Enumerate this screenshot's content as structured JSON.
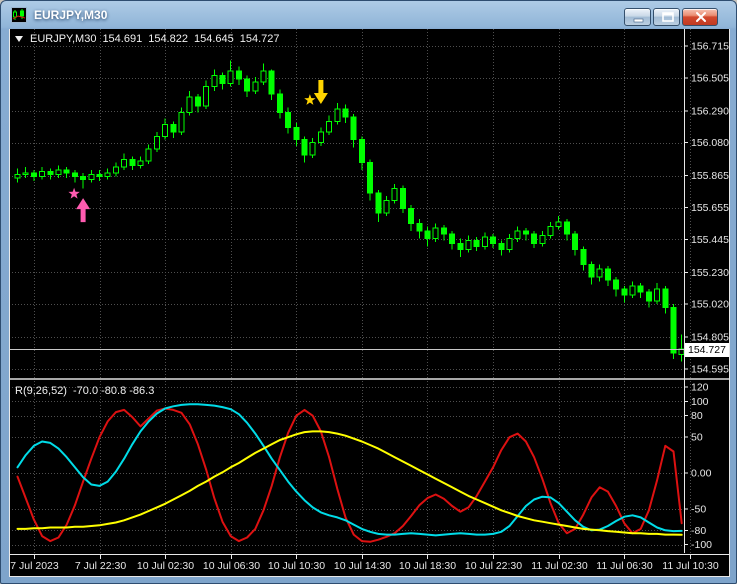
{
  "window": {
    "title": "EURJPY,M30",
    "controls": [
      {
        "name": "minimize"
      },
      {
        "name": "maximize"
      },
      {
        "name": "close"
      }
    ]
  },
  "quote": {
    "symbol": "EURJPY,M30",
    "open": "154.691",
    "high": "154.822",
    "low": "154.645",
    "close": "154.727",
    "bid": "154.727"
  },
  "indicator_header": {
    "name": "R(9,26,52)",
    "values": "-70.0 -80.8 -86.3"
  },
  "colors": {
    "background": "#000000",
    "grid": "#4f4f4f",
    "axis_text": "#e6e6e6",
    "axis_line": "#e8e8e8",
    "separator": "#a8a8a8",
    "bull": "#00ff00",
    "bid_line": "#c8c8c8",
    "red_line": "#dd1111",
    "cyan_line": "#00dce8",
    "yellow_line": "#ffff00",
    "buy_marker": "#ff5bb0",
    "sell_marker": "#ffd400"
  },
  "chart_data": [
    {
      "type": "candlestick",
      "title": "EURJPY,M30",
      "ylim": [
        154.595,
        156.715
      ],
      "y_ticks": [
        "156.715",
        "156.505",
        "156.290",
        "156.080",
        "155.865",
        "155.655",
        "155.445",
        "155.230",
        "155.020",
        "154.805",
        "154.595"
      ],
      "x_ticks": {
        "labels": [
          "7 Jul 2023",
          "7 Jul 22:30",
          "10 Jul 02:30",
          "10 Jul 06:30",
          "10 Jul 10:30",
          "10 Jul 14:30",
          "10 Jul 18:30",
          "10 Jul 22:30",
          "11 Jul 02:30",
          "11 Jul 06:30",
          "11 Jul 10:30"
        ],
        "first_bar": 2,
        "bar_step": 8
      },
      "bid": 154.727,
      "ohlc": [
        [
          155.85,
          155.91,
          155.82,
          155.87
        ],
        [
          155.87,
          155.92,
          155.85,
          155.88
        ],
        [
          155.88,
          155.9,
          155.83,
          155.86
        ],
        [
          155.86,
          155.92,
          155.84,
          155.89
        ],
        [
          155.89,
          155.91,
          155.84,
          155.87
        ],
        [
          155.87,
          155.93,
          155.85,
          155.9
        ],
        [
          155.9,
          155.92,
          155.85,
          155.88
        ],
        [
          155.88,
          155.9,
          155.82,
          155.86
        ],
        [
          155.86,
          155.88,
          155.78,
          155.84
        ],
        [
          155.84,
          155.9,
          155.82,
          155.87
        ],
        [
          155.87,
          155.9,
          155.83,
          155.86
        ],
        [
          155.86,
          155.91,
          155.84,
          155.88
        ],
        [
          155.88,
          155.95,
          155.86,
          155.92
        ],
        [
          155.92,
          156.01,
          155.9,
          155.97
        ],
        [
          155.97,
          155.99,
          155.9,
          155.93
        ],
        [
          155.93,
          155.99,
          155.91,
          155.96
        ],
        [
          155.96,
          156.07,
          155.94,
          156.04
        ],
        [
          156.04,
          156.15,
          156.02,
          156.12
        ],
        [
          156.12,
          156.24,
          156.1,
          156.2
        ],
        [
          156.2,
          156.22,
          156.11,
          156.15
        ],
        [
          156.15,
          156.31,
          156.13,
          156.28
        ],
        [
          156.28,
          156.42,
          156.26,
          156.38
        ],
        [
          156.38,
          156.4,
          156.28,
          156.32
        ],
        [
          156.32,
          156.49,
          156.3,
          156.45
        ],
        [
          156.45,
          156.56,
          156.42,
          156.52
        ],
        [
          156.52,
          156.54,
          156.43,
          156.47
        ],
        [
          156.47,
          156.62,
          156.45,
          156.55
        ],
        [
          156.55,
          156.58,
          156.46,
          156.5
        ],
        [
          156.5,
          156.52,
          156.38,
          156.42
        ],
        [
          156.42,
          156.51,
          156.4,
          156.48
        ],
        [
          156.48,
          156.6,
          156.46,
          156.55
        ],
        [
          156.55,
          156.56,
          156.36,
          156.4
        ],
        [
          156.4,
          156.43,
          156.24,
          156.28
        ],
        [
          156.28,
          156.31,
          156.14,
          156.18
        ],
        [
          156.18,
          156.21,
          156.06,
          156.1
        ],
        [
          156.1,
          156.12,
          155.95,
          156.0
        ],
        [
          156.0,
          156.11,
          155.98,
          156.08
        ],
        [
          156.08,
          156.18,
          156.06,
          156.15
        ],
        [
          156.15,
          156.26,
          156.13,
          156.22
        ],
        [
          156.22,
          156.34,
          156.2,
          156.3
        ],
        [
          156.3,
          156.33,
          156.21,
          156.25
        ],
        [
          156.25,
          156.27,
          156.05,
          156.1
        ],
        [
          156.1,
          156.12,
          155.9,
          155.95
        ],
        [
          155.95,
          155.97,
          155.7,
          155.75
        ],
        [
          155.75,
          155.77,
          155.56,
          155.62
        ],
        [
          155.62,
          155.73,
          155.6,
          155.7
        ],
        [
          155.7,
          155.81,
          155.68,
          155.78
        ],
        [
          155.78,
          155.8,
          155.62,
          155.65
        ],
        [
          155.65,
          155.67,
          155.5,
          155.55
        ],
        [
          155.55,
          155.58,
          155.45,
          155.5
        ],
        [
          155.5,
          155.53,
          155.4,
          155.45
        ],
        [
          155.45,
          155.55,
          155.43,
          155.52
        ],
        [
          155.52,
          155.54,
          155.44,
          155.48
        ],
        [
          155.48,
          155.5,
          155.38,
          155.42
        ],
        [
          155.42,
          155.45,
          155.33,
          155.38
        ],
        [
          155.38,
          155.47,
          155.36,
          155.44
        ],
        [
          155.44,
          155.46,
          155.37,
          155.4
        ],
        [
          155.4,
          155.49,
          155.38,
          155.46
        ],
        [
          155.46,
          155.48,
          155.39,
          155.42
        ],
        [
          155.42,
          155.44,
          155.34,
          155.38
        ],
        [
          155.38,
          155.48,
          155.36,
          155.45
        ],
        [
          155.45,
          155.53,
          155.43,
          155.5
        ],
        [
          155.5,
          155.52,
          155.44,
          155.48
        ],
        [
          155.48,
          155.5,
          155.39,
          155.42
        ],
        [
          155.42,
          155.5,
          155.4,
          155.47
        ],
        [
          155.47,
          155.56,
          155.45,
          155.53
        ],
        [
          155.53,
          155.6,
          155.51,
          155.56
        ],
        [
          155.56,
          155.58,
          155.44,
          155.48
        ],
        [
          155.48,
          155.5,
          155.34,
          155.38
        ],
        [
          155.38,
          155.4,
          155.24,
          155.28
        ],
        [
          155.28,
          155.3,
          155.15,
          155.2
        ],
        [
          155.2,
          155.28,
          155.17,
          155.25
        ],
        [
          155.25,
          155.27,
          155.14,
          155.18
        ],
        [
          155.18,
          155.2,
          155.07,
          155.12
        ],
        [
          155.12,
          155.14,
          155.03,
          155.08
        ],
        [
          155.08,
          155.17,
          155.06,
          155.14
        ],
        [
          155.14,
          155.16,
          155.06,
          155.1
        ],
        [
          155.1,
          155.12,
          155.0,
          155.04
        ],
        [
          155.04,
          155.16,
          155.02,
          155.12
        ],
        [
          155.12,
          155.14,
          154.96,
          155.0
        ],
        [
          155.0,
          155.02,
          154.66,
          154.7
        ],
        [
          154.691,
          154.822,
          154.645,
          154.727
        ]
      ],
      "markers": [
        {
          "name": "buy-signal-arrow",
          "shape": "arrow-up",
          "color_key": "buy_marker",
          "bar": 8,
          "price": 155.717,
          "star_price": 155.745,
          "star_dx": -9
        },
        {
          "name": "sell-signal-arrow",
          "shape": "arrow-down",
          "color_key": "sell_marker",
          "bar": 37,
          "price": 156.334,
          "star_price": 156.36,
          "star_dx": -11
        }
      ]
    },
    {
      "type": "line",
      "title": "R(9,26,52)",
      "current_values": [
        -70.0,
        -80.8,
        -86.3
      ],
      "ylim": [
        -120,
        120
      ],
      "levels": [
        {
          "label": "120",
          "value": 120
        },
        {
          "label": "100",
          "value": 100
        },
        {
          "label": "80",
          "value": 80
        },
        {
          "label": "50",
          "value": 50
        },
        {
          "label": "0.00",
          "value": 0
        },
        {
          "label": "-50",
          "value": -50
        },
        {
          "label": "-80",
          "value": -80
        },
        {
          "label": "-100",
          "value": -100
        }
      ],
      "series": [
        {
          "name": "fast",
          "color_key": "red_line",
          "values": [
            -5,
            -35,
            -65,
            -88,
            -95,
            -90,
            -72,
            -45,
            -12,
            20,
            50,
            72,
            85,
            88,
            78,
            65,
            76,
            87,
            90,
            88,
            84,
            68,
            40,
            5,
            -35,
            -68,
            -88,
            -95,
            -90,
            -78,
            -52,
            -18,
            22,
            56,
            80,
            88,
            80,
            58,
            22,
            -22,
            -62,
            -86,
            -95,
            -96,
            -93,
            -89,
            -84,
            -74,
            -60,
            -45,
            -35,
            -30,
            -36,
            -46,
            -54,
            -48,
            -32,
            -12,
            8,
            32,
            50,
            55,
            44,
            22,
            -8,
            -42,
            -70,
            -84,
            -78,
            -58,
            -34,
            -20,
            -26,
            -46,
            -70,
            -84,
            -78,
            -52,
            -10,
            38,
            30,
            -70
          ]
        },
        {
          "name": "medium",
          "color_key": "cyan_line",
          "values": [
            8,
            25,
            38,
            44,
            42,
            34,
            22,
            8,
            -6,
            -16,
            -18,
            -12,
            2,
            20,
            40,
            58,
            72,
            83,
            90,
            93,
            95,
            96,
            96,
            95,
            94,
            92,
            89,
            82,
            70,
            55,
            38,
            20,
            4,
            -12,
            -26,
            -38,
            -48,
            -55,
            -59,
            -62,
            -66,
            -72,
            -78,
            -82,
            -85,
            -86,
            -86,
            -85,
            -84,
            -85,
            -86,
            -87,
            -86,
            -85,
            -84,
            -85,
            -86,
            -86,
            -85,
            -82,
            -74,
            -60,
            -46,
            -37,
            -33,
            -34,
            -42,
            -54,
            -66,
            -75,
            -80,
            -79,
            -74,
            -67,
            -61,
            -59,
            -62,
            -69,
            -76,
            -80,
            -81,
            -80.8
          ]
        },
        {
          "name": "slow",
          "color_key": "yellow_line",
          "values": [
            -78,
            -78,
            -77,
            -77,
            -76,
            -76,
            -76,
            -75,
            -75,
            -74,
            -73,
            -71,
            -69,
            -66,
            -62,
            -58,
            -53,
            -48,
            -43,
            -37,
            -31,
            -25,
            -18,
            -12,
            -5,
            1,
            8,
            14,
            21,
            28,
            34,
            40,
            46,
            50,
            54,
            57,
            58,
            58,
            57,
            55,
            52,
            48,
            44,
            39,
            34,
            28,
            22,
            16,
            10,
            4,
            -2,
            -8,
            -14,
            -20,
            -26,
            -32,
            -37,
            -42,
            -47,
            -52,
            -56,
            -60,
            -63,
            -66,
            -68,
            -70,
            -72,
            -74,
            -76,
            -78,
            -79,
            -80,
            -81,
            -82,
            -83,
            -84,
            -84,
            -85,
            -85,
            -86,
            -86,
            -86.3
          ]
        }
      ]
    }
  ]
}
